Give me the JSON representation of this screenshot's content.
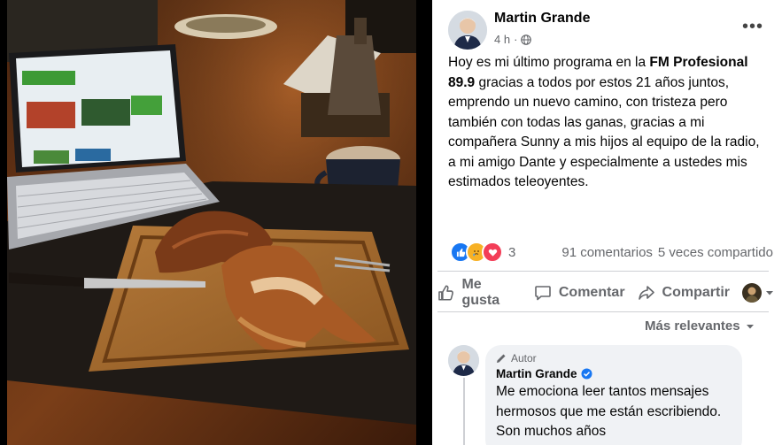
{
  "post": {
    "author": "Martin Grande",
    "time": "4 h",
    "privacy_icon": "globe-icon",
    "text_before": "Hoy es mi último programa en la ",
    "text_bold": "FM Profesional 89.9",
    "text_after": " gracias a todos por estos 21 años juntos, emprendo un nuevo camino, con tristeza pero también con todas las ganas, gracias a mi compañera Sunny a mis hijos al equipo de la radio, a mi amigo Dante y especialmente a ustedes mis estimados teleoyentes."
  },
  "reactions": {
    "count": "3",
    "comments": "91 comentarios",
    "shares": "5 veces compartido",
    "icons": [
      "like-icon",
      "care-icon",
      "love-icon"
    ],
    "colors": {
      "like": "#1877f2",
      "care": "#f7b125",
      "love": "#f33e58"
    }
  },
  "actions": {
    "like": "Me gusta",
    "comment": "Comentar",
    "share": "Compartir"
  },
  "sort": {
    "label": "Más relevantes"
  },
  "comment": {
    "role": "Autor",
    "name": "Martin Grande",
    "text": "Me emociona leer tantos mensajes hermosos que me están escribiendo. Son muchos años"
  },
  "colors": {
    "accent": "#1877f2",
    "secondary_text": "#65676b",
    "bubble": "#f0f2f5"
  }
}
